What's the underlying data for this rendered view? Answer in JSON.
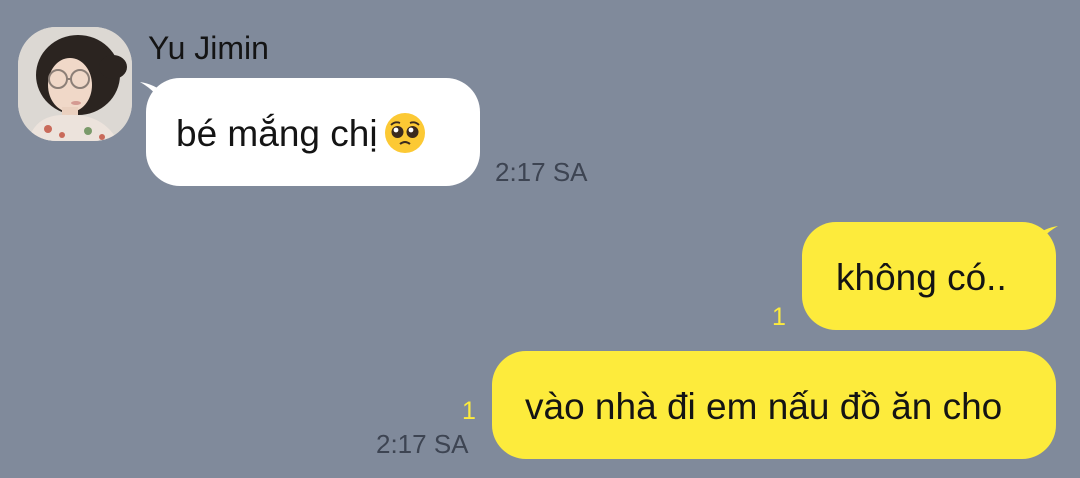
{
  "chat": {
    "sender_name": "Yu Jimin",
    "messages": [
      {
        "direction": "incoming",
        "text": "bé mắng chị",
        "emoji": "pleading-face-emoji",
        "time": "2:17 SA"
      },
      {
        "direction": "outgoing",
        "text": "không có..",
        "unread": "1"
      },
      {
        "direction": "outgoing",
        "text": "vào nhà đi em nấu đồ ăn cho",
        "unread": "1",
        "time": "2:17 SA"
      }
    ]
  },
  "colors": {
    "background": "#808a9b",
    "incoming_bubble": "#ffffff",
    "outgoing_bubble": "#fdeb3c",
    "unread_count": "#fdeb3c",
    "timestamp": "#3d4452"
  }
}
